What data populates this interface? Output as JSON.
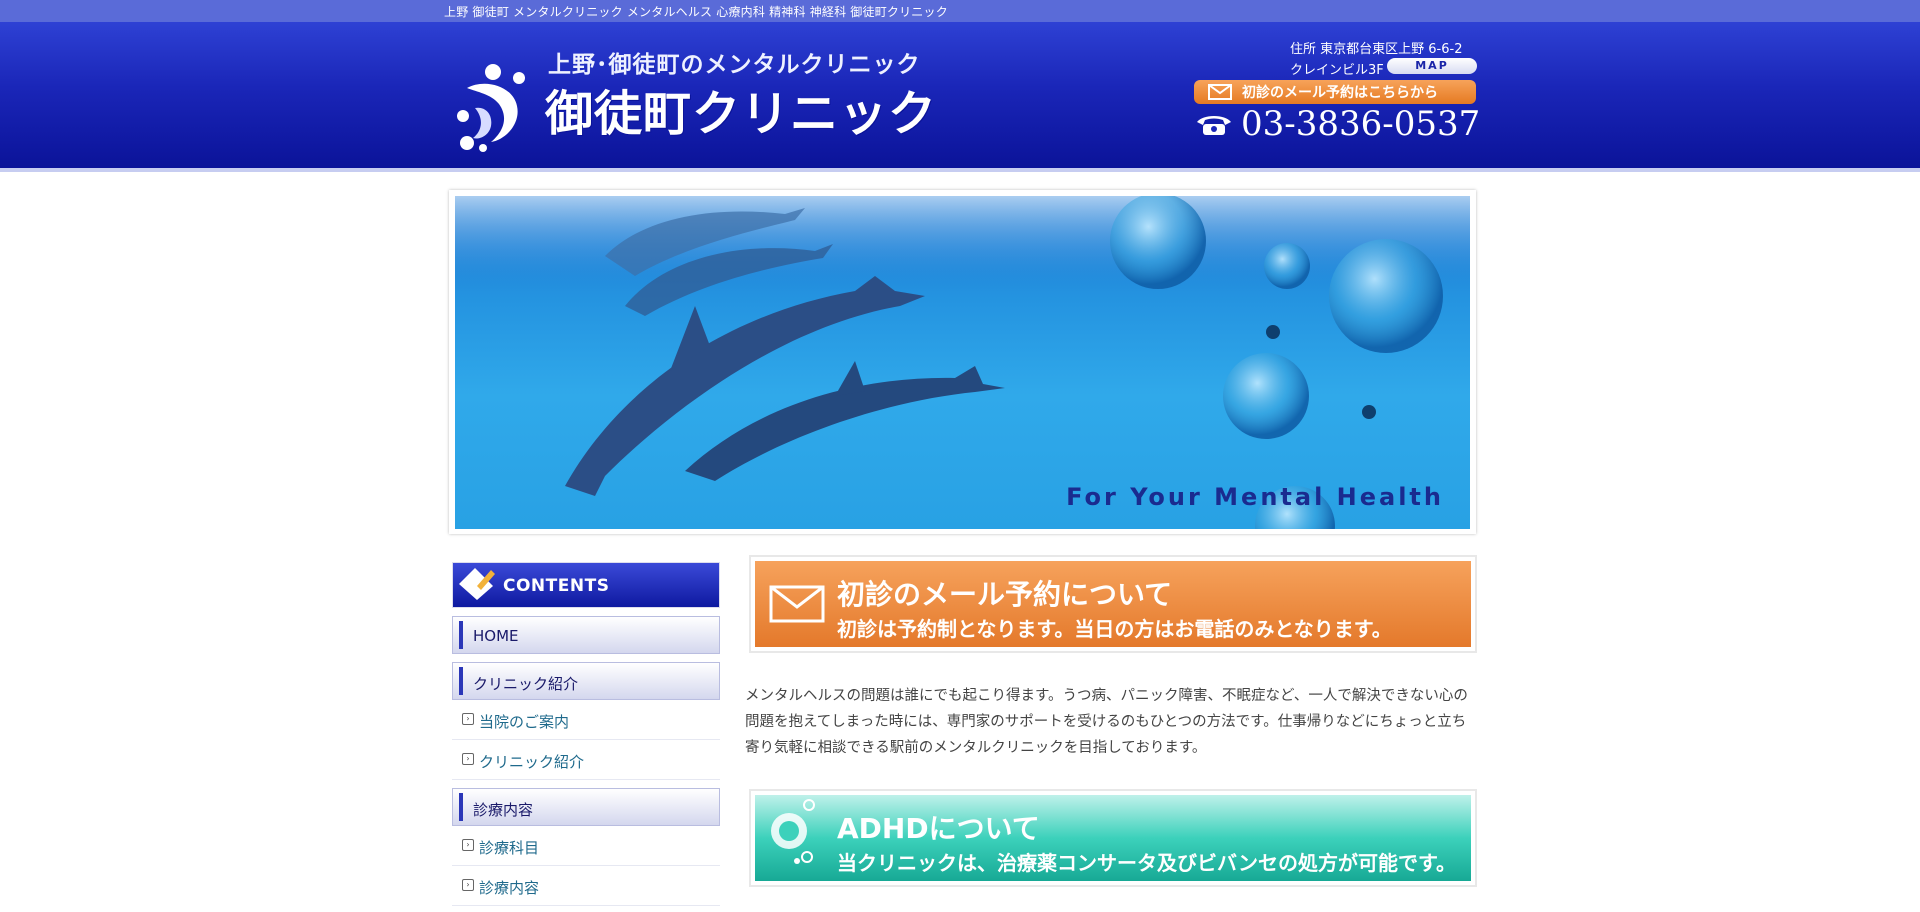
{
  "topbar": {
    "text": "上野 御徒町 メンタルクリニック メンタルヘルス 心療内科 精神科 神経科 御徒町クリニック"
  },
  "header": {
    "subtitle": "上野･御徒町のメンタルクリニック",
    "clinic_name": "御徒町クリニック",
    "address_line1": "住所 東京都台東区上野 6-6-2",
    "address_line2": "クレインビル3F",
    "map_label": "MAP",
    "mail_label": "初診のメール予約はこちらから",
    "phone": "03-3836-0537"
  },
  "hero": {
    "caption": "For Your Mental Health"
  },
  "sidebar": {
    "contents_label": "CONTENTS",
    "home": "HOME",
    "section1": "クリニック紹介",
    "section1_items": [
      "当院のご案内",
      "クリニック紹介"
    ],
    "section2": "診療内容",
    "section2_items": [
      "診療科目",
      "診療内容"
    ]
  },
  "main": {
    "banner1": {
      "title": "初診のメール予約について",
      "desc": "初診は予約制となります。当日の方はお電話のみとなります。"
    },
    "intro": "メンタルヘルスの問題は誰にでも起こり得ます。うつ病、パニック障害、不眠症など、一人で解決できない心の問題を抱えてしまった時には、専門家のサポートを受けるのもひとつの方法です。仕事帰りなどにちょっと立ち寄り気軽に相談できる駅前のメンタルクリニックを目指しております。",
    "banner2": {
      "title": "ADHDについて",
      "desc": "当クリニックは、治療薬コンサータ及びビバンセの処方が可能です。"
    }
  },
  "colors": {
    "header_dark": "#0b1399",
    "header_light": "#2e41d4",
    "accent_orange": "#e57a22",
    "accent_teal": "#17a995"
  }
}
